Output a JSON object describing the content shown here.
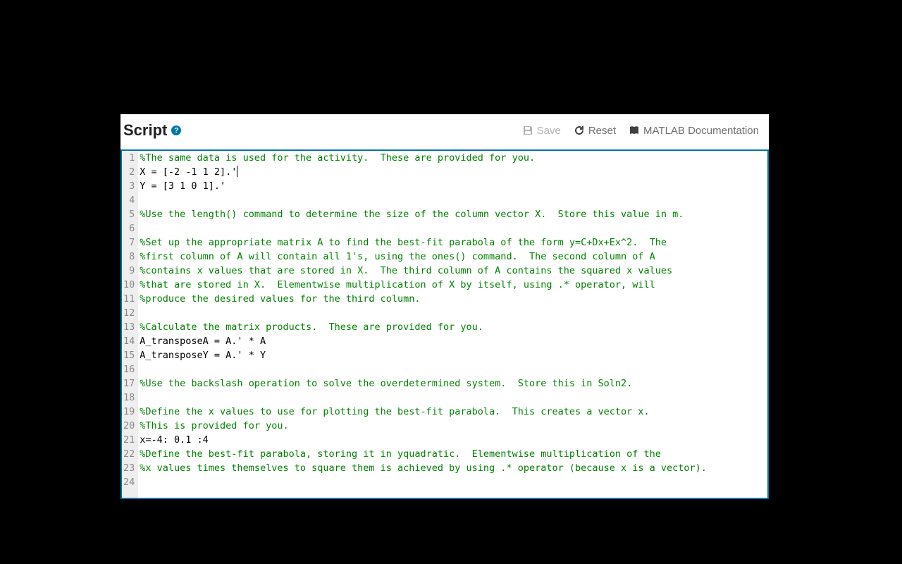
{
  "header": {
    "title": "Script",
    "help_symbol": "?"
  },
  "toolbar": {
    "save_label": "Save",
    "reset_label": "Reset",
    "docs_label": "MATLAB Documentation"
  },
  "editor": {
    "cursor_line": 2,
    "lines": [
      {
        "n": 1,
        "type": "comment",
        "text": "%The same data is used for the activity.  These are provided for you."
      },
      {
        "n": 2,
        "type": "code",
        "text": "X = [-2 -1 1 2].'"
      },
      {
        "n": 3,
        "type": "code",
        "text": "Y = [3 1 0 1].'"
      },
      {
        "n": 4,
        "type": "blank",
        "text": ""
      },
      {
        "n": 5,
        "type": "comment",
        "text": "%Use the length() command to determine the size of the column vector X.  Store this value in m."
      },
      {
        "n": 6,
        "type": "blank",
        "text": ""
      },
      {
        "n": 7,
        "type": "comment",
        "text": "%Set up the appropriate matrix A to find the best-fit parabola of the form y=C+Dx+Ex^2.  The"
      },
      {
        "n": 8,
        "type": "comment",
        "text": "%first column of A will contain all 1's, using the ones() command.  The second column of A"
      },
      {
        "n": 9,
        "type": "comment",
        "text": "%contains x values that are stored in X.  The third column of A contains the squared x values"
      },
      {
        "n": 10,
        "type": "comment",
        "text": "%that are stored in X.  Elementwise multiplication of X by itself, using .* operator, will"
      },
      {
        "n": 11,
        "type": "comment",
        "text": "%produce the desired values for the third column."
      },
      {
        "n": 12,
        "type": "blank",
        "text": ""
      },
      {
        "n": 13,
        "type": "comment",
        "text": "%Calculate the matrix products.  These are provided for you."
      },
      {
        "n": 14,
        "type": "code",
        "text": "A_transposeA = A.' * A"
      },
      {
        "n": 15,
        "type": "code",
        "text": "A_transposeY = A.' * Y"
      },
      {
        "n": 16,
        "type": "blank",
        "text": ""
      },
      {
        "n": 17,
        "type": "comment",
        "text": "%Use the backslash operation to solve the overdetermined system.  Store this in Soln2."
      },
      {
        "n": 18,
        "type": "blank",
        "text": ""
      },
      {
        "n": 19,
        "type": "comment",
        "text": "%Define the x values to use for plotting the best-fit parabola.  This creates a vector x."
      },
      {
        "n": 20,
        "type": "comment",
        "text": "%This is provided for you."
      },
      {
        "n": 21,
        "type": "code",
        "text": "x=-4: 0.1 :4"
      },
      {
        "n": 22,
        "type": "comment",
        "text": "%Define the best-fit parabola, storing it in yquadratic.  Elementwise multiplication of the"
      },
      {
        "n": 23,
        "type": "comment",
        "text": "%x values times themselves to square them is achieved by using .* operator (because x is a vector)."
      },
      {
        "n": 24,
        "type": "blank",
        "text": ""
      }
    ]
  }
}
